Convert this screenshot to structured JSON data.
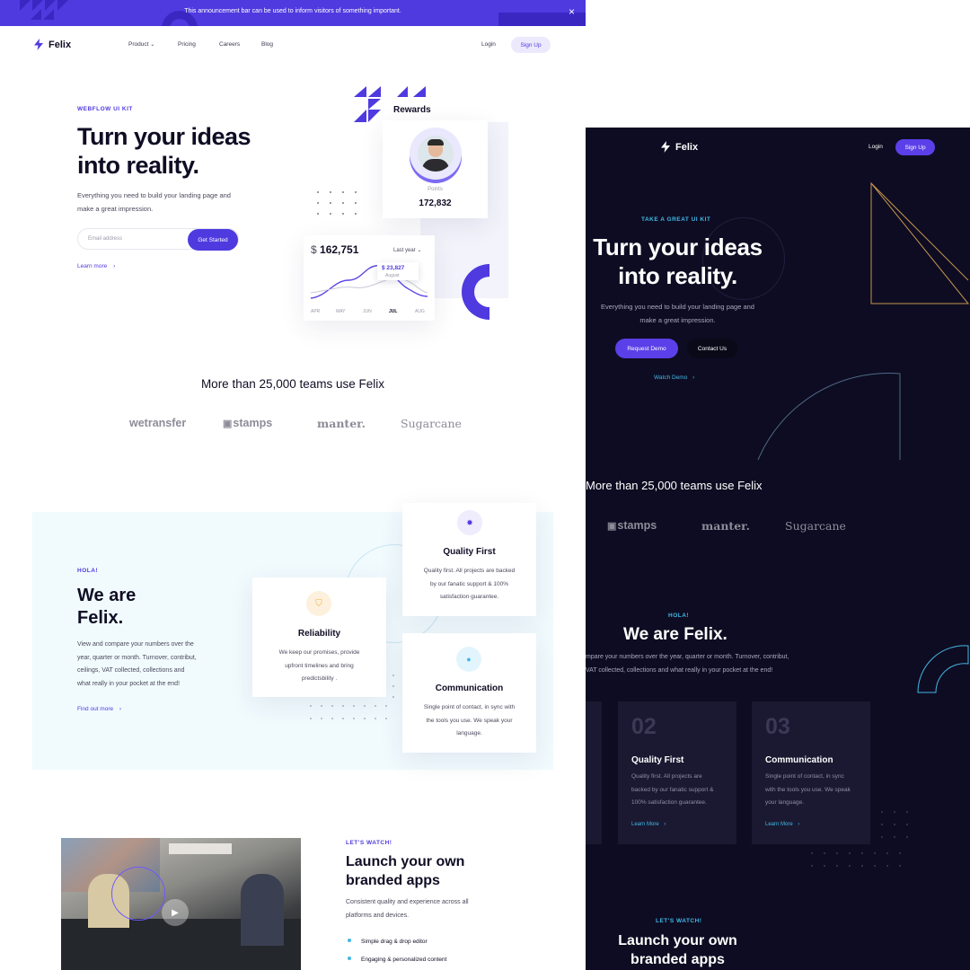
{
  "colors": {
    "accent": "#4f3ae0",
    "cyan": "#43b7e6",
    "dark_bg": "#0e0c22",
    "dark_card": "#1a1931"
  },
  "light": {
    "announcement": {
      "text": "This announcement bar can be used to inform visitors of something important.",
      "close_icon": "close-icon"
    },
    "nav": {
      "logo": "Felix",
      "logo_icon": "bolt-icon",
      "links": [
        "Product",
        "Pricing",
        "Careers",
        "Blog"
      ],
      "login": "Login",
      "signup": "Sign Up"
    },
    "hero": {
      "eyebrow": "WEBFLOW UI KIT",
      "title_line1": "Turn your ideas",
      "title_line2": "into reality.",
      "subtitle_line1": "Everything you need to build your landing page and",
      "subtitle_line2": "make a great impression.",
      "email_placeholder": "Email address",
      "cta": "Get Started",
      "learn_more": "Learn more"
    },
    "rewards": {
      "label": "Rewards",
      "points_label": "Points",
      "points_value": "172,832"
    },
    "stats": {
      "currency": "$",
      "amount": "162,751",
      "period": "Last year",
      "tooltip_value": "$ 23,827",
      "tooltip_month": "August",
      "months": [
        "APR",
        "MAY",
        "JUN",
        "JUL",
        "AUG"
      ],
      "active_month": "JUL"
    },
    "teams": {
      "heading": "More than 25,000 teams use Felix",
      "logos": [
        "wetransfer",
        "stamps",
        "manter.",
        "Sugarcane"
      ]
    },
    "about": {
      "eyebrow": "HOLA!",
      "title_line1": "We are",
      "title_line2": "Felix.",
      "body_lines": [
        "View and compare your numbers over the",
        "year, quarter or month. Turnover, contribut,",
        "ceilings, VAT collected, collections and",
        "what really in your pocket at the end!"
      ],
      "link": "Find out more",
      "features": [
        {
          "title": "Reliability",
          "lines": [
            "We  keep our promises, provide",
            "upfront timelines and bring",
            "predictsbility ."
          ]
        },
        {
          "title": "Quality First",
          "lines": [
            "Quality first. All projects are backed",
            "by our fanatic support & 100%",
            "satisfaction guarantee."
          ]
        },
        {
          "title": "Communication",
          "lines": [
            "Single point of contact, in sync with",
            "the tools you use. We speak your",
            "language."
          ]
        }
      ]
    },
    "watch": {
      "eyebrow": "LET'S WATCH!",
      "title_line1": "Launch your own",
      "title_line2": "branded apps",
      "body_line1": "Consistent quality and experience across all",
      "body_line2": "platforms and devices.",
      "bullets": [
        "Simple drag & drop editor",
        "Engaging & personalized content"
      ]
    }
  },
  "dark": {
    "nav": {
      "logo": "Felix",
      "login": "Login",
      "signup": "Sign Up"
    },
    "hero": {
      "eyebrow": "TAKE A GREAT UI KIT",
      "title_line1": "Turn your ideas",
      "title_line2": "into reality.",
      "subtitle_line1": "Everything you need to build your landing page and",
      "subtitle_line2": "make a great impression.",
      "cta_primary": "Request Demo",
      "cta_secondary": "Contact Us",
      "watch_demo": "Watch Demo"
    },
    "teams": {
      "heading": "More than 25,000 teams use Felix",
      "logos": [
        "stamps",
        "manter.",
        "Sugarcane"
      ]
    },
    "about": {
      "eyebrow": "HOLA!",
      "title": "We are Felix.",
      "body_line1": "mpare your numbers over the year, quarter or month. Turnover, contribut,",
      "body_line2": "VAT collected, collections and what really in your pocket at the end!",
      "cards": [
        {
          "num": "02",
          "title": "Quality First",
          "lines": [
            "Quality first. All projects are",
            "backed by our fanatic support &",
            "100% satisfaction guarantee."
          ],
          "link": "Learn More"
        },
        {
          "num": "03",
          "title": "Communication",
          "lines": [
            "Single point of contact, in sync",
            "with the tools you use. We speak",
            "your language."
          ],
          "link": "Learn More"
        }
      ]
    },
    "watch": {
      "eyebrow": "LET'S WATCH!",
      "title_line1": "Launch your own",
      "title_line2": "branded apps"
    }
  }
}
